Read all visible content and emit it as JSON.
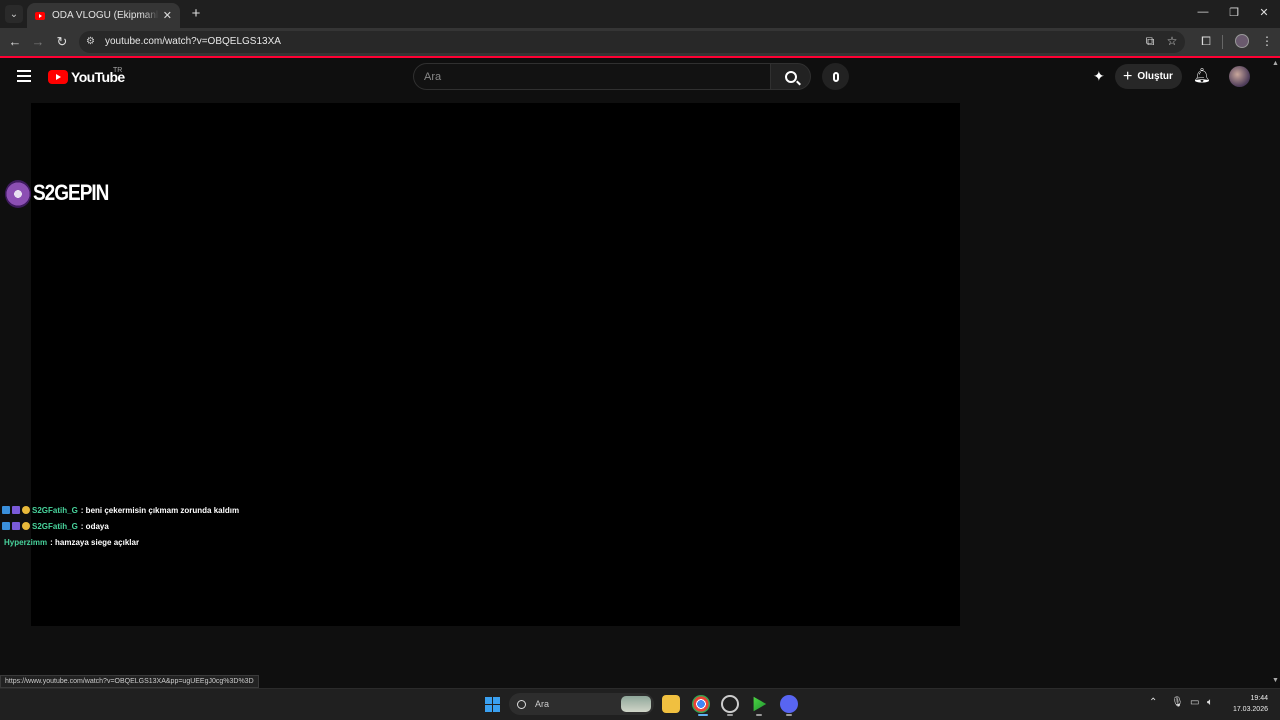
{
  "browser": {
    "tab_title": "ODA VLOGU (Ekipmanlarım) - YouTube",
    "tab_close": "✕",
    "new_tab": "+",
    "url": "youtube.com/watch?v=OBQELGS13XA",
    "window_controls": [
      "—",
      "❐",
      "✕"
    ]
  },
  "youtube": {
    "logo_text": "YouTube",
    "region": "TR",
    "search_placeholder": "Ara",
    "create_label": "Oluştur"
  },
  "video": {
    "overlay_logo": "S2GEPIN",
    "chat": [
      {
        "user": "S2GFatih_G",
        "message": ": beni çekermisin çıkmam zorunda kaldım",
        "badges": true
      },
      {
        "user": "S2GFatih_G",
        "message": ": odaya",
        "badges": true
      },
      {
        "user": "Hyperzimm",
        "message": ": hamzaya siege açıklar",
        "badges": false
      }
    ]
  },
  "status_url": "https://www.youtube.com/watch?v=OBQELGS13XA&pp=ugUEEgJ0cg%3D%3D",
  "taskbar": {
    "search_placeholder": "Ara",
    "time": "19:44",
    "date": "17.03.2026"
  }
}
